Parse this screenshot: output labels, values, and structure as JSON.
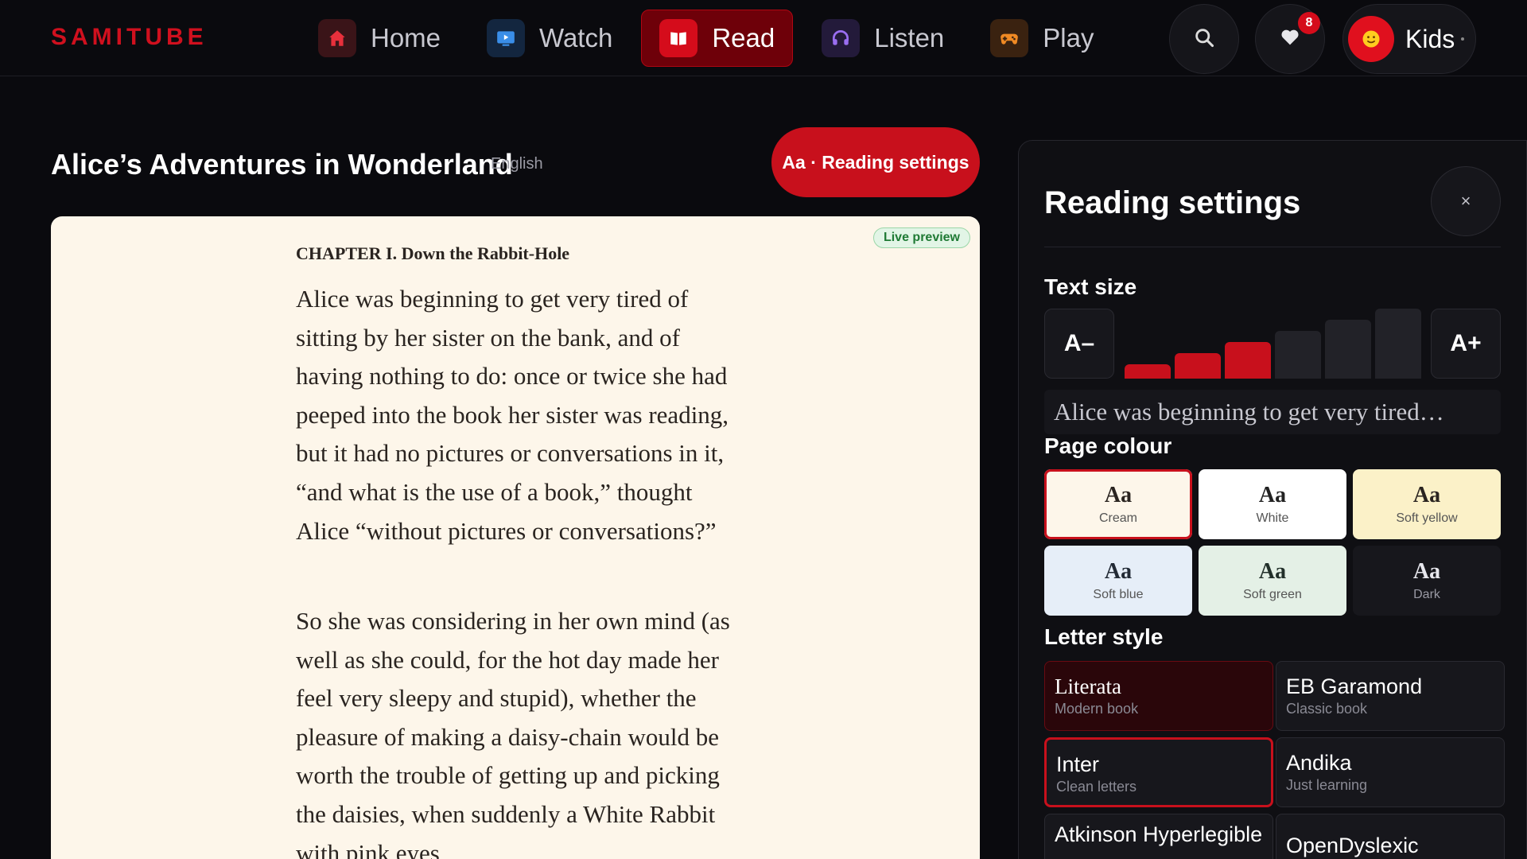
{
  "brand": {
    "name": "SAMITUBE",
    "accent": "#d0101e"
  },
  "nav": {
    "items": [
      {
        "label": "Home",
        "icon": "home-icon",
        "active": false
      },
      {
        "label": "Watch",
        "icon": "tv-icon",
        "active": false
      },
      {
        "label": "Read",
        "icon": "book-icon",
        "active": true
      },
      {
        "label": "Listen",
        "icon": "headphones-icon",
        "active": false
      },
      {
        "label": "Play",
        "icon": "gamepad-icon",
        "active": false
      }
    ]
  },
  "header": {
    "favorites_badge": "8",
    "profile_label": "Kids",
    "profile_icon": "smiley-icon"
  },
  "book": {
    "title": "Alice’s Adventures in Wonderland",
    "language": "English",
    "settings_button": "Aa · Reading settings"
  },
  "reader": {
    "badge": "Live preview",
    "chapter": "CHAPTER I. Down the Rabbit-Hole",
    "paragraphs": [
      "Alice was beginning to get very tired of sitting by her sister on the bank, and of having nothing to do: once or twice she had peeped into the book her sister was reading, but it had no pictures or conversations in it, “and what is the use of a book,” thought Alice “without pictures or conversations?”",
      "So she was considering in her own mind (as well as she could, for the hot day made her feel very sleepy and stupid), whether the pleasure of making a daisy-chain would be worth the trouble of getting up and picking the daisies, when suddenly a White Rabbit with pink eyes"
    ]
  },
  "settings": {
    "title": "Reading settings",
    "close_label": "×",
    "text_size": {
      "label": "Text size",
      "decrease": "A–",
      "increase": "A+",
      "level": 3,
      "levels": 6,
      "sample": "Alice was beginning to get very tired…"
    },
    "page_colour": {
      "label": "Page colour",
      "selected": "Cream",
      "options": [
        {
          "aa": "Aa",
          "name": "Cream",
          "bg": "#fdf6ea",
          "fg": "#2a2420",
          "sub": "#555"
        },
        {
          "aa": "Aa",
          "name": "White",
          "bg": "#ffffff",
          "fg": "#222222",
          "sub": "#555"
        },
        {
          "aa": "Aa",
          "name": "Soft yellow",
          "bg": "#fbf1c8",
          "fg": "#2a2420",
          "sub": "#555"
        },
        {
          "aa": "Aa",
          "name": "Soft blue",
          "bg": "#e6eef8",
          "fg": "#222a35",
          "sub": "#555"
        },
        {
          "aa": "Aa",
          "name": "Soft green",
          "bg": "#e4f0e6",
          "fg": "#22302a",
          "sub": "#555"
        },
        {
          "aa": "Aa",
          "name": "Dark",
          "bg": "#17171c",
          "fg": "#e8e8ee",
          "sub": "#9a9aa4"
        }
      ]
    },
    "letter_style": {
      "label": "Letter style",
      "options": [
        {
          "name": "Literata",
          "sub": "Modern book",
          "serif": true,
          "state": "selected"
        },
        {
          "name": "EB Garamond",
          "sub": "Classic book",
          "serif": false,
          "state": ""
        },
        {
          "name": "Inter",
          "sub": "Clean letters",
          "serif": false,
          "state": "focused"
        },
        {
          "name": "Andika",
          "sub": "Just learning",
          "serif": false,
          "state": ""
        },
        {
          "name": "Atkinson Hyperlegible",
          "sub": "",
          "serif": false,
          "state": ""
        },
        {
          "name": "OpenDyslexic",
          "sub": "",
          "serif": false,
          "state": ""
        }
      ]
    }
  }
}
